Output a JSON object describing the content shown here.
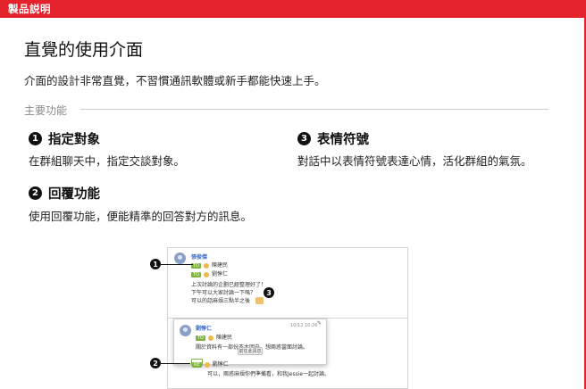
{
  "header": {
    "label": "製品説明"
  },
  "page": {
    "title": "直覺的使用介面",
    "subtitle": "介面的設計非常直覺，不習慣通訊軟體或新手都能快速上手。",
    "section_label": "主要功能"
  },
  "features": [
    {
      "number": "1",
      "title": "指定對象",
      "desc": "在群組聊天中，指定交談對象。"
    },
    {
      "number": "2",
      "title": "回覆功能",
      "desc": "使用回覆功能，便能精準的回答對方的訊息。"
    },
    {
      "number": "3",
      "title": "表情符號",
      "desc": "對話中以表情符號表達心情，活化群組的氣氛。"
    }
  ],
  "screenshot": {
    "sender": "張俊傑",
    "to_tag": "TO",
    "to_name_1": "陳建民",
    "to_name_2": "劉惇仁",
    "line_1": "上次討論的企劃已經整理好了！",
    "line_2": "下午可以大家討論一下嗎？",
    "line_3": "可以的話麻煩三點半之後",
    "popup_sender": "劉惇仁",
    "popup_time": "10/12 10:26",
    "popup_to_name": "陳建民",
    "popup_text": "關於資料有一部份不太明白，想兩惑當面討論。",
    "popup_button": "前往此訊息",
    "reply_tag": "RE",
    "reply_name": "劉惇仁",
    "reply_text": "可以，兩惑麻煩你們準備看，和我Jessie一起討論。"
  },
  "callouts": [
    "1",
    "2",
    "3"
  ],
  "colors": {
    "brand_red": "#e3222b",
    "tag_green": "#7fb241",
    "sender_blue": "#3a6ac6"
  }
}
